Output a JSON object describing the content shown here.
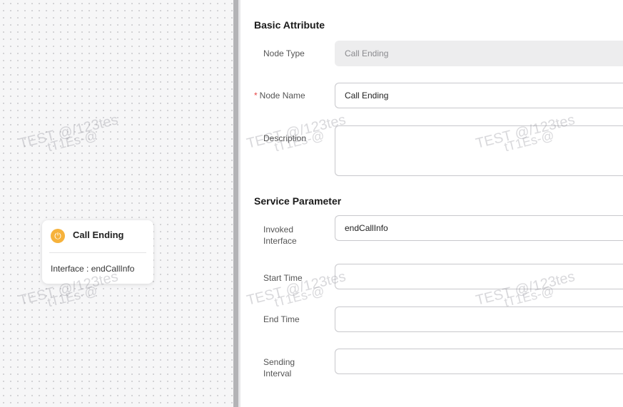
{
  "canvas": {
    "node": {
      "icon": "power-icon",
      "title": "Call Ending",
      "interface_text": "Interface : endCallInfo"
    }
  },
  "form": {
    "basic": {
      "title": "Basic Attribute",
      "node_type_label": "Node Type",
      "node_type_value": "Call Ending",
      "node_name_label": "Node Name",
      "node_name_required": "*",
      "node_name_value": "Call Ending",
      "description_label": "Description",
      "description_value": ""
    },
    "service": {
      "title": "Service Parameter",
      "invoked_interface_label": "Invoked Interface",
      "invoked_interface_value": "endCallInfo",
      "start_time_label": "Start Time",
      "start_time_value": "",
      "end_time_label": "End Time",
      "end_time_value": "",
      "sending_interval_label": "Sending Interval",
      "sending_interval_value": ""
    }
  },
  "watermark": {
    "line1": "TEST @/123tes",
    "line2": "tT1Es-@"
  },
  "colors": {
    "node_icon": "#f6b23b",
    "required_mark": "#e64545"
  }
}
